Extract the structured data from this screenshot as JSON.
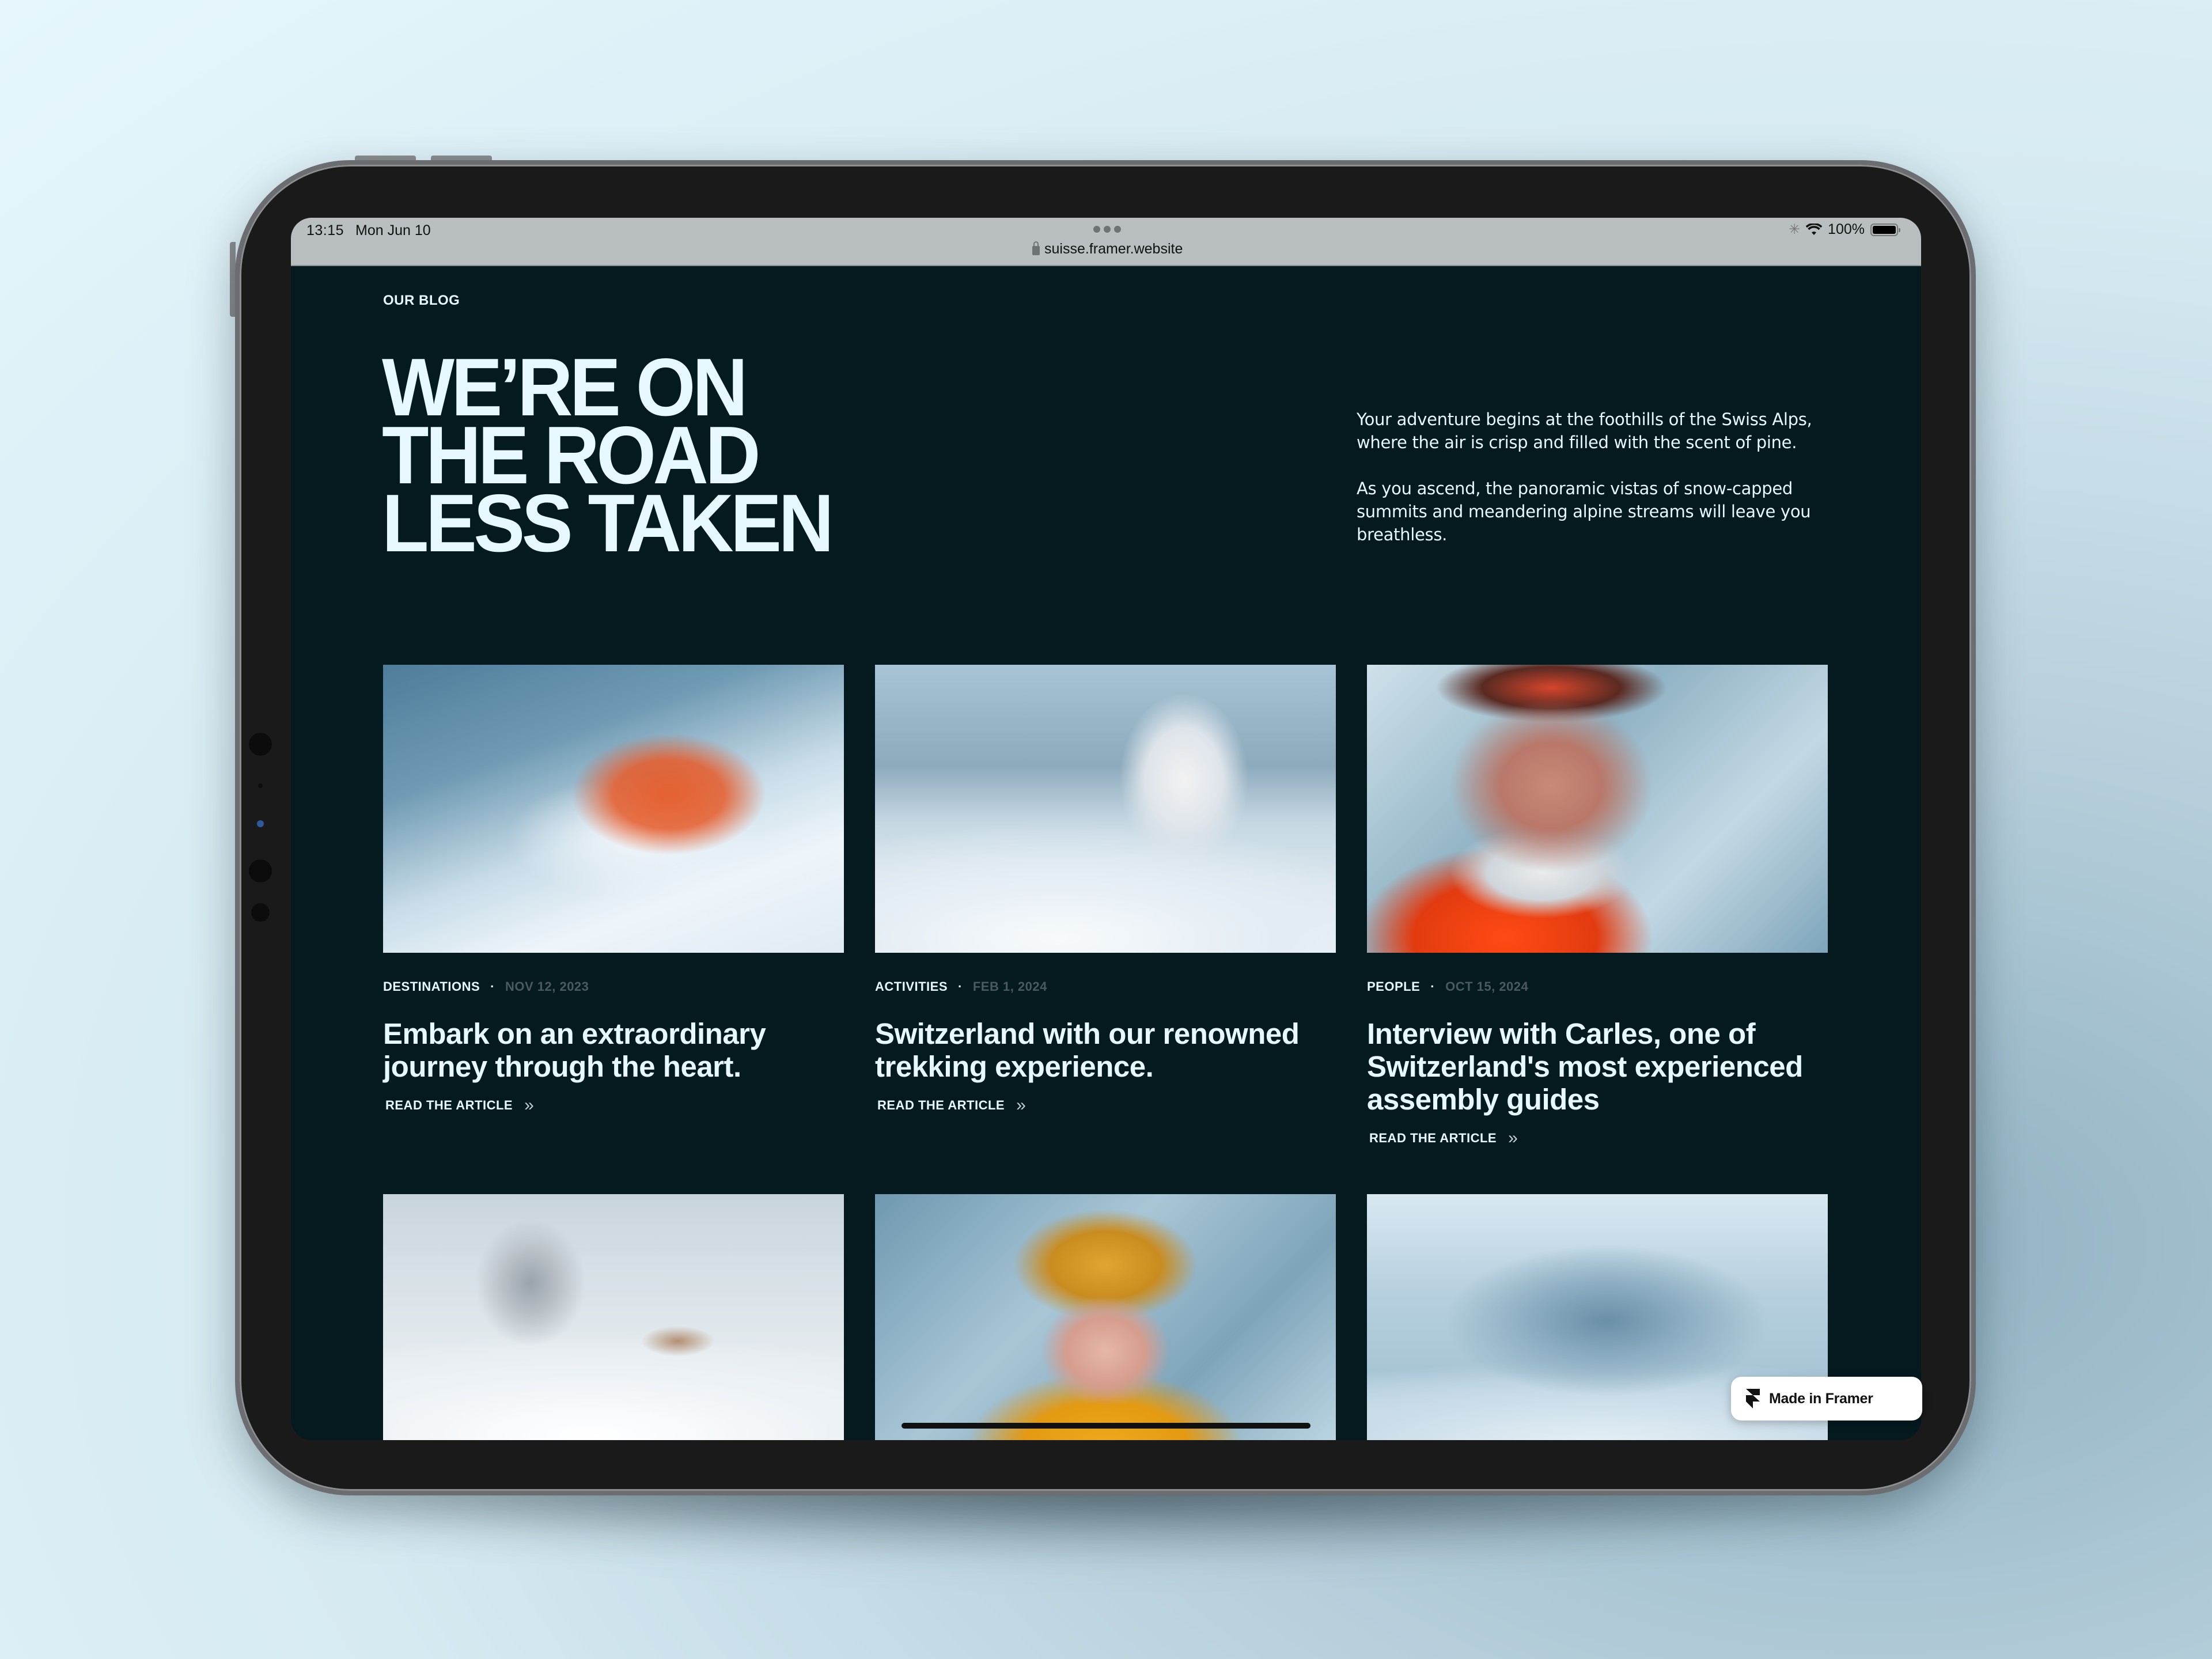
{
  "status_bar": {
    "time": "13:15",
    "date": "Mon Jun 10",
    "url": "suisse.framer.website",
    "battery_percent_label": "100%",
    "battery_level": 1.0,
    "icons": [
      "activity-spinner-icon",
      "wifi-icon",
      "battery-icon",
      "lock-icon",
      "more-dots-icon"
    ]
  },
  "page": {
    "eyebrow": "OUR BLOG",
    "hero_lines": [
      "WE’RE ON",
      "THE ROAD",
      "LESS TAKEN"
    ],
    "intro": [
      "Your adventure begins at the foothills of the Swiss Alps, where the air is crisp and filled with the scent of pine.",
      "As you ascend, the panoramic vistas of snow-capped summits and meandering alpine streams will leave you breathless."
    ]
  },
  "articles": [
    {
      "category": "DESTINATIONS",
      "separator": "·",
      "date": "NOV 12, 2023",
      "title": "Embark on an extraordinary journey through the heart.",
      "link_label": "READ THE ARTICLE",
      "link_icon": "double-chevron-right-icon",
      "image": "snowboarder-in-powder"
    },
    {
      "category": "ACTIVITIES",
      "separator": "·",
      "date": "FEB 1, 2024",
      "title": "Switzerland with our renowned trekking experience.",
      "link_label": "READ THE ARTICLE",
      "link_icon": "double-chevron-right-icon",
      "image": "snowy-tree-on-hill"
    },
    {
      "category": "PEOPLE",
      "separator": "·",
      "date": "OCT 15, 2024",
      "title": "Interview with Carles, one of Switzerland's most experienced assembly guides",
      "link_label": "READ THE ARTICLE",
      "link_icon": "double-chevron-right-icon",
      "image": "bearded-mountaineer-portrait"
    }
  ],
  "more_articles_images": [
    "snowy-cabin-with-tree",
    "woman-in-yellow-beanie",
    "snowy-mountain-peaks"
  ],
  "badge": {
    "label": "Made in Framer",
    "icon": "framer-logo-icon"
  },
  "colors": {
    "page_bg": "#041a1f",
    "text": "#e8f8ff",
    "muted_date": "#4a5a60",
    "status_bar_bg": "#b9bec0"
  }
}
